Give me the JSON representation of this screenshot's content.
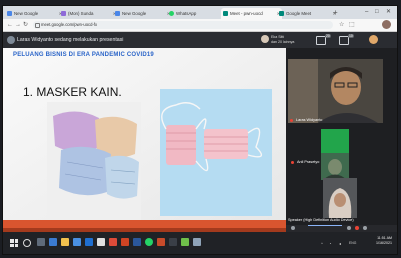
{
  "browser": {
    "tabs": [
      {
        "label": "New Google"
      },
      {
        "label": "(Mon) Sunda"
      },
      {
        "label": "New Google"
      },
      {
        "label": "WhatsApp"
      },
      {
        "label": "Meet - pwn-uocd"
      },
      {
        "label": "Google Meet"
      }
    ],
    "new_tab_label": "+",
    "url": "meet.google.com/pwn-uocd-fx"
  },
  "meet": {
    "presenting_text": "Laras Widyanto sedang melakukan presentasi",
    "others_line1": "Eka Sitti",
    "others_line2": "dan 20 lainnya",
    "badge_participants": "20",
    "badge_chat": "10",
    "participant_self": "Laras Widyanto",
    "participant_2": "Anil Prasetyo",
    "participant_3": "Speaker (High Definition Audio Device)"
  },
  "slide": {
    "title": "PELUANG BISNIS DI ERA PANDEMIC COVID19",
    "heading": "1. MASKER KAIN."
  },
  "taskbar": {
    "time": "11:51 AM",
    "date": "1/16/2021",
    "lang": "ENG"
  },
  "colors": {
    "slide_title": "#2a64c8",
    "slide_footer": "#d9552f",
    "meet_dark": "#202124",
    "tile_green": "#22a54b"
  }
}
